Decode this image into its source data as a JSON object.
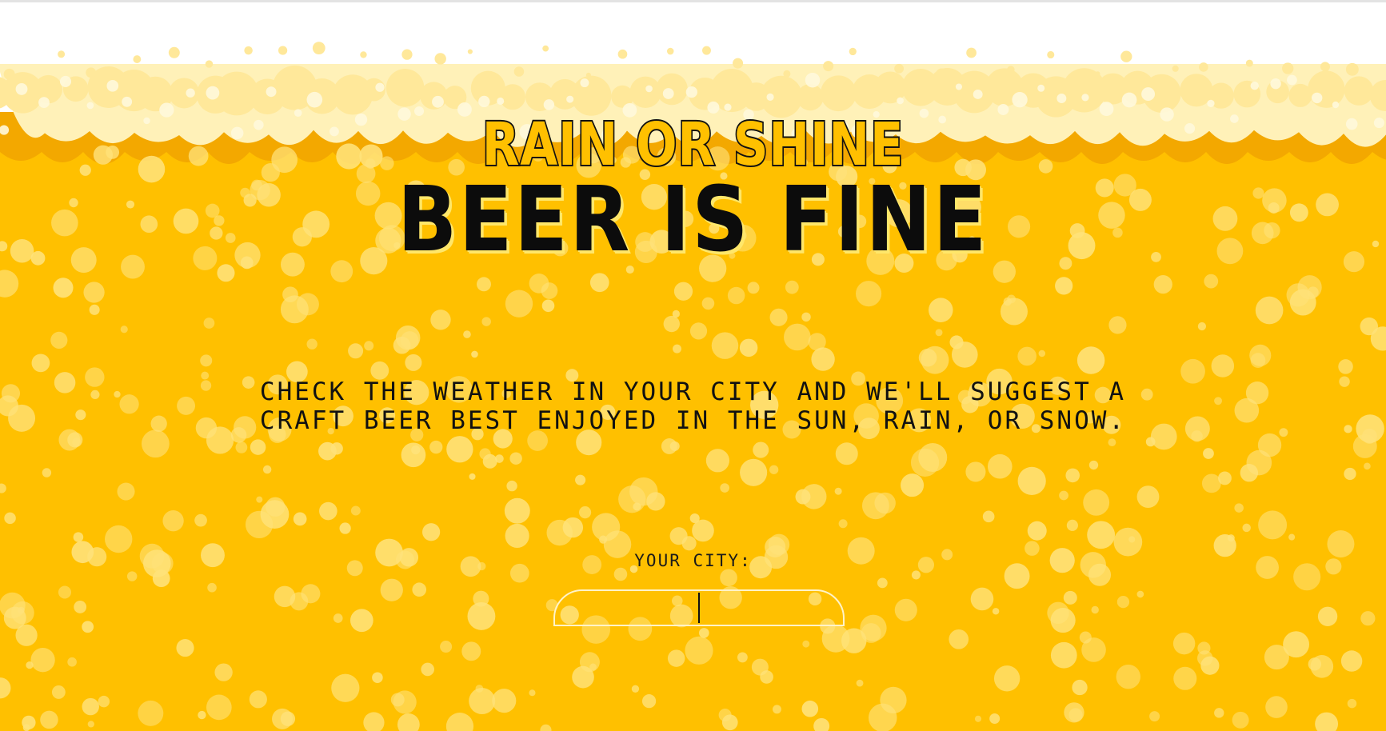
{
  "colors": {
    "beer": "#ffc000",
    "beer_dark": "#f3a800",
    "foam": "#fff1b8",
    "foam_light": "#ffe89a",
    "bubble": "#ffe27a",
    "ink": "#111111"
  },
  "hero": {
    "title_top": "RAIN OR SHINE",
    "title_main": "BEER IS FINE"
  },
  "intro": {
    "text": "CHECK THE WEATHER IN YOUR CITY AND WE'LL SUGGEST A CRAFT BEER BEST ENJOYED IN THE SUN, RAIN, OR SNOW."
  },
  "form": {
    "city_label": "YOUR CITY:",
    "city_value": "",
    "city_placeholder": ""
  }
}
